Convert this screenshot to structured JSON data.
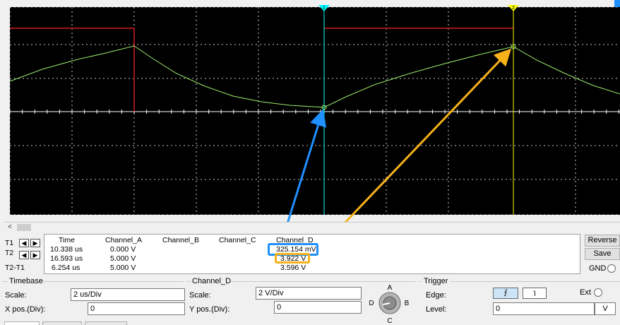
{
  "readout": {
    "headers": [
      "Time",
      "Channel_A",
      "Channel_B",
      "Channel_C",
      "Channel_D"
    ],
    "rows": [
      {
        "label": "T1",
        "time": "10.338 us",
        "a": "0.000 V",
        "b": "",
        "c": "",
        "d": "325.154 mV"
      },
      {
        "label": "T2",
        "time": "16.593 us",
        "a": "5.000 V",
        "b": "",
        "c": "",
        "d": "3.922 V"
      },
      {
        "label": "T2-T1",
        "time": "6.254 us",
        "a": "5.000 V",
        "b": "",
        "c": "",
        "d": "3.596 V"
      }
    ],
    "arrow_left": "◀",
    "arrow_right": "▶"
  },
  "buttons": {
    "reverse": "Reverse",
    "save": "Save",
    "gnd": "GND"
  },
  "timebase": {
    "title": "Timebase",
    "scale_label": "Scale:",
    "scale_value": "2 us/Div",
    "xpos_label": "X pos.(Div):",
    "xpos_value": "0"
  },
  "channel": {
    "title": "Channel_D",
    "scale_label": "Scale:",
    "scale_value": "2  V/Div",
    "ypos_label": "Y pos.(Div):",
    "ypos_value": "0",
    "knob_a": "A",
    "knob_b": "B",
    "knob_c": "C",
    "knob_d": "D"
  },
  "trigger": {
    "title": "Trigger",
    "edge_label": "Edge:",
    "level_label": "Level:",
    "level_value": "0",
    "level_unit": "V",
    "ext_label": "Ext",
    "edge_rise": "⨍",
    "edge_fall": "ɿ"
  },
  "cursors": {
    "t1_label": "1",
    "t2_label": "2",
    "t1_color": "#00ffff",
    "t2_color": "#ffff00"
  },
  "colors": {
    "screen": "#000000",
    "grid": "#ffffff",
    "channel_a": "#d21b1b",
    "channel_d": "#9bea6a",
    "annotation_blue": "#1e90ff",
    "annotation_orange": "#f7b21a"
  },
  "scroll": {
    "left_arrow": "<"
  }
}
